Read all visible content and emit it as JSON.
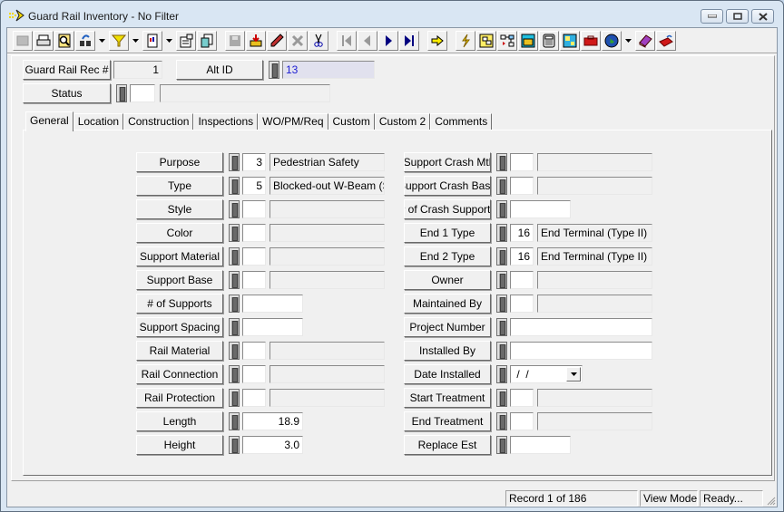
{
  "window": {
    "title": "Guard Rail Inventory - No Filter",
    "controls": [
      "minimize",
      "maximize",
      "close"
    ]
  },
  "toolbar": {
    "buttons": [
      {
        "icon": "grid-view-icon",
        "disabled": true
      },
      {
        "icon": "print-icon"
      },
      {
        "icon": "print-preview-icon"
      },
      {
        "icon": "find-icon",
        "dropdown": true
      },
      {
        "icon": "filter-icon",
        "dropdown": true
      },
      {
        "icon": "report-icon",
        "dropdown": true
      },
      {
        "icon": "properties-icon"
      },
      {
        "icon": "copy-record-icon"
      },
      {
        "icon": "save-icon",
        "disabled": true
      },
      {
        "icon": "add-record-icon"
      },
      {
        "icon": "edit-icon"
      },
      {
        "icon": "delete-icon",
        "disabled": true
      },
      {
        "icon": "cut-icon"
      },
      {
        "icon": "first-record-icon",
        "disabled": true
      },
      {
        "icon": "previous-record-icon",
        "disabled": true
      },
      {
        "icon": "next-record-icon"
      },
      {
        "icon": "last-record-icon"
      },
      {
        "icon": "goto-arrow-icon"
      },
      {
        "icon": "lightning-icon"
      },
      {
        "icon": "work-order-icon"
      },
      {
        "icon": "relationship-icon"
      },
      {
        "icon": "map-icon"
      },
      {
        "icon": "calculator-icon"
      },
      {
        "icon": "chart-icon"
      },
      {
        "icon": "toolbox-icon"
      },
      {
        "icon": "globe-icon",
        "dropdown": true
      },
      {
        "icon": "book-icon"
      },
      {
        "icon": "exit-icon"
      }
    ]
  },
  "header": {
    "rec_label": "Guard Rail Rec #",
    "rec_value": "1",
    "alt_id_label": "Alt ID",
    "alt_id_value": "13",
    "status_label": "Status",
    "status_code": "",
    "status_desc": ""
  },
  "tabs": [
    {
      "label": "General",
      "active": true
    },
    {
      "label": "Location"
    },
    {
      "label": "Construction"
    },
    {
      "label": "Inspections"
    },
    {
      "label": "WO/PM/Req"
    },
    {
      "label": "Custom"
    },
    {
      "label": "Custom 2"
    },
    {
      "label": "Comments"
    }
  ],
  "left_fields": [
    {
      "label": "Purpose",
      "code": "3",
      "desc": "Pedestrian Safety",
      "kind": "lookup"
    },
    {
      "label": "Type",
      "code": "5",
      "desc": "Blocked-out W-Beam (SP)",
      "kind": "lookup"
    },
    {
      "label": "Style",
      "code": "",
      "desc": "",
      "kind": "lookup"
    },
    {
      "label": "Color",
      "code": "",
      "desc": "",
      "kind": "lookup"
    },
    {
      "label": "Support Material",
      "code": "",
      "desc": "",
      "kind": "lookup"
    },
    {
      "label": "Support Base",
      "code": "",
      "desc": "",
      "kind": "lookup"
    },
    {
      "label": "# of Supports",
      "value": "",
      "kind": "short"
    },
    {
      "label": "Support Spacing",
      "value": "",
      "kind": "short"
    },
    {
      "label": "Rail Material",
      "code": "",
      "desc": "",
      "kind": "lookup"
    },
    {
      "label": "Rail Connection",
      "code": "",
      "desc": "",
      "kind": "lookup"
    },
    {
      "label": "Rail Protection",
      "code": "",
      "desc": "",
      "kind": "lookup"
    },
    {
      "label": "Length",
      "value": "18.9",
      "kind": "short"
    },
    {
      "label": "Height",
      "value": "3.0",
      "kind": "short"
    }
  ],
  "right_fields": [
    {
      "label": "Support Crash Mtl",
      "code": "",
      "desc": "",
      "kind": "lookup"
    },
    {
      "label": "Support Crash Base",
      "code": "",
      "desc": "",
      "kind": "lookup"
    },
    {
      "label": "# of Crash Supports",
      "value": "",
      "kind": "short"
    },
    {
      "label": "End 1 Type",
      "code": "16",
      "desc": "End Terminal (Type II)",
      "kind": "lookup"
    },
    {
      "label": "End 2 Type",
      "code": "16",
      "desc": "End Terminal (Type II)",
      "kind": "lookup"
    },
    {
      "label": "Owner",
      "code": "",
      "desc": "",
      "kind": "lookup"
    },
    {
      "label": "Maintained By",
      "code": "",
      "desc": "",
      "kind": "lookup"
    },
    {
      "label": "Project Number",
      "value": "",
      "kind": "long"
    },
    {
      "label": "Installed By",
      "value": "",
      "kind": "long"
    },
    {
      "label": "Date Installed",
      "value": " /  /",
      "kind": "date"
    },
    {
      "label": "Start Treatment",
      "code": "",
      "desc": "",
      "kind": "lookup"
    },
    {
      "label": "End Treatment",
      "code": "",
      "desc": "",
      "kind": "lookup"
    },
    {
      "label": "Replace Est",
      "value": "",
      "kind": "short"
    }
  ],
  "statusbar": {
    "record": "Record 1 of 186",
    "mode": "View Mode",
    "state": "Ready..."
  }
}
